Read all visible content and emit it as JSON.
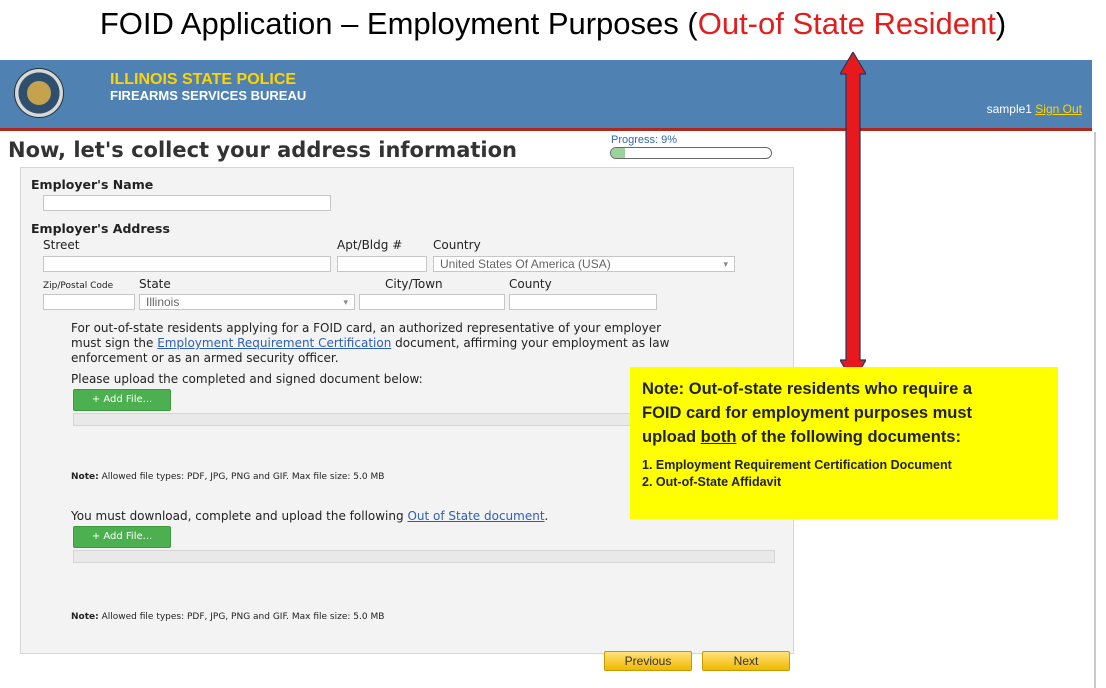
{
  "slide": {
    "title_prefix": "FOID Application – Employment Purposes (",
    "title_highlight": "Out-of State Resident",
    "title_suffix": ")"
  },
  "header": {
    "agency": "ILLINOIS STATE POLICE",
    "bureau": "FIREARMS SERVICES BUREAU",
    "username": "sample1",
    "signout": "Sign Out"
  },
  "page": {
    "heading": "Now, let's collect your address information",
    "progress_label": "Progress: 9%",
    "progress_value": 0.09
  },
  "form": {
    "employer_name_label": "Employer's Name",
    "employer_address_label": "Employer's Address",
    "street_label": "Street",
    "apt_label": "Apt/Bldg #",
    "country_label": "Country",
    "country_value": "United States Of America (USA)",
    "zip_label": "Zip/Postal Code",
    "state_label": "State",
    "state_value": "Illinois",
    "city_label": "City/Town",
    "county_label": "County",
    "para_part1": "For out-of-state residents applying for a FOID card, an authorized representative of your employer",
    "para_part2": "must sign the",
    "para_link": "Employment Requirement Certification",
    "para_part3": "document, affirming your employment as law",
    "para_part4": "enforcement or as an armed security officer.",
    "upload_instruction": "Please upload the completed and signed document below:",
    "add_file_label": "+ Add File...",
    "note_prefix": "Note:",
    "note_text": "Allowed file types: PDF, JPG, PNG and GIF. Max file size: 5.0 MB",
    "download_text": "You must download, complete and upload the following",
    "download_link": "Out of State document",
    "download_suffix": ".",
    "add_file_label_2": "+ Add File...",
    "note_prefix_2": "Note:",
    "note_text_2": "Allowed file types: PDF, JPG, PNG and GIF. Max file size: 5.0 MB"
  },
  "buttons": {
    "previous": "Previous",
    "next": "Next"
  },
  "callout": {
    "line1": "Note: Out-of-state residents who require a",
    "line2": "FOID card for employment purposes must",
    "line3_prefix": "upload",
    "line3_emph": "both",
    "line3_suffix": "of the following documents:",
    "item1": "1. Employment Requirement Certification Document",
    "item2": "2. Out-of-State Affidavit"
  },
  "colors": {
    "header_bg": "#4f81b3",
    "agency_text": "#ffd400",
    "callout_bg": "#ffff00",
    "arrow": "#e8191c",
    "title_highlight": "#e31d1d"
  }
}
